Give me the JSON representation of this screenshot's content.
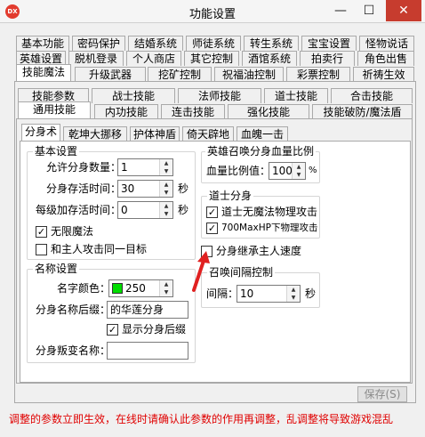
{
  "window": {
    "title": "功能设置",
    "icon_label": "DX",
    "minimize": "—",
    "maximize": "☐",
    "close": "✕"
  },
  "tabs_row1": [
    "基本功能",
    "密码保护",
    "结婚系统",
    "师徒系统",
    "转生系统",
    "宝宝设置",
    "怪物说话"
  ],
  "tabs_row2": [
    "英雄设置",
    "脱机登录",
    "个人商店",
    "其它控制",
    "酒馆系统",
    "拍卖行",
    "角色出售"
  ],
  "tabs_row3": [
    "技能魔法",
    "升级武器",
    "挖矿控制",
    "祝福油控制",
    "彩票控制",
    "祈祷生效"
  ],
  "tabs_row4": [
    "技能参数",
    "战士技能",
    "法师技能",
    "道士技能",
    "合击技能"
  ],
  "tabs_row5": [
    "通用技能",
    "内功技能",
    "连击技能",
    "强化技能",
    "技能破防/魔法盾"
  ],
  "tabs_row6": [
    "分身术",
    "乾坤大挪移",
    "护体神盾",
    "倚天辟地",
    "血魄一击"
  ],
  "basic": {
    "title": "基本设置",
    "max_clones_label": "允许分身数量：",
    "max_clones_value": "1",
    "survive_label": "分身存活时间：",
    "survive_value": "30",
    "survive_unit": "秒",
    "per_level_label": "每级加存活时间：",
    "per_level_value": "0",
    "per_level_unit": "秒",
    "unlimited_magic": "无限魔法",
    "attack_same": "和主人攻击同一目标"
  },
  "naming": {
    "title": "名称设置",
    "color_label": "名字颜色：",
    "color_value": "250",
    "color_hex": "#00dd00",
    "suffix_label": "分身名称后缀：",
    "suffix_value": "的华莲分身",
    "show_suffix": "显示分身后缀",
    "transform_label": "分身叛变名称："
  },
  "hero": {
    "title": "英雄召唤分身血量比例",
    "ratio_label": "血量比例值：",
    "ratio_value": "100",
    "ratio_unit": "%"
  },
  "taoist": {
    "title": "道士分身",
    "opt1": "道士无魔法物理攻击",
    "opt2": "700MaxHP下物理攻击"
  },
  "inherit": {
    "label": "分身继承主人速度"
  },
  "summon": {
    "title": "召唤间隔控制",
    "interval_label": "间隔：",
    "interval_value": "10",
    "interval_unit": "秒"
  },
  "save_label": "保存(S)",
  "bottom_notice": "调整的参数立即生效，在线时请确认此参数的作用再调整，乱调整将导致游戏混乱",
  "colors": {
    "notice": "#e00000",
    "arrow": "#e02020"
  }
}
